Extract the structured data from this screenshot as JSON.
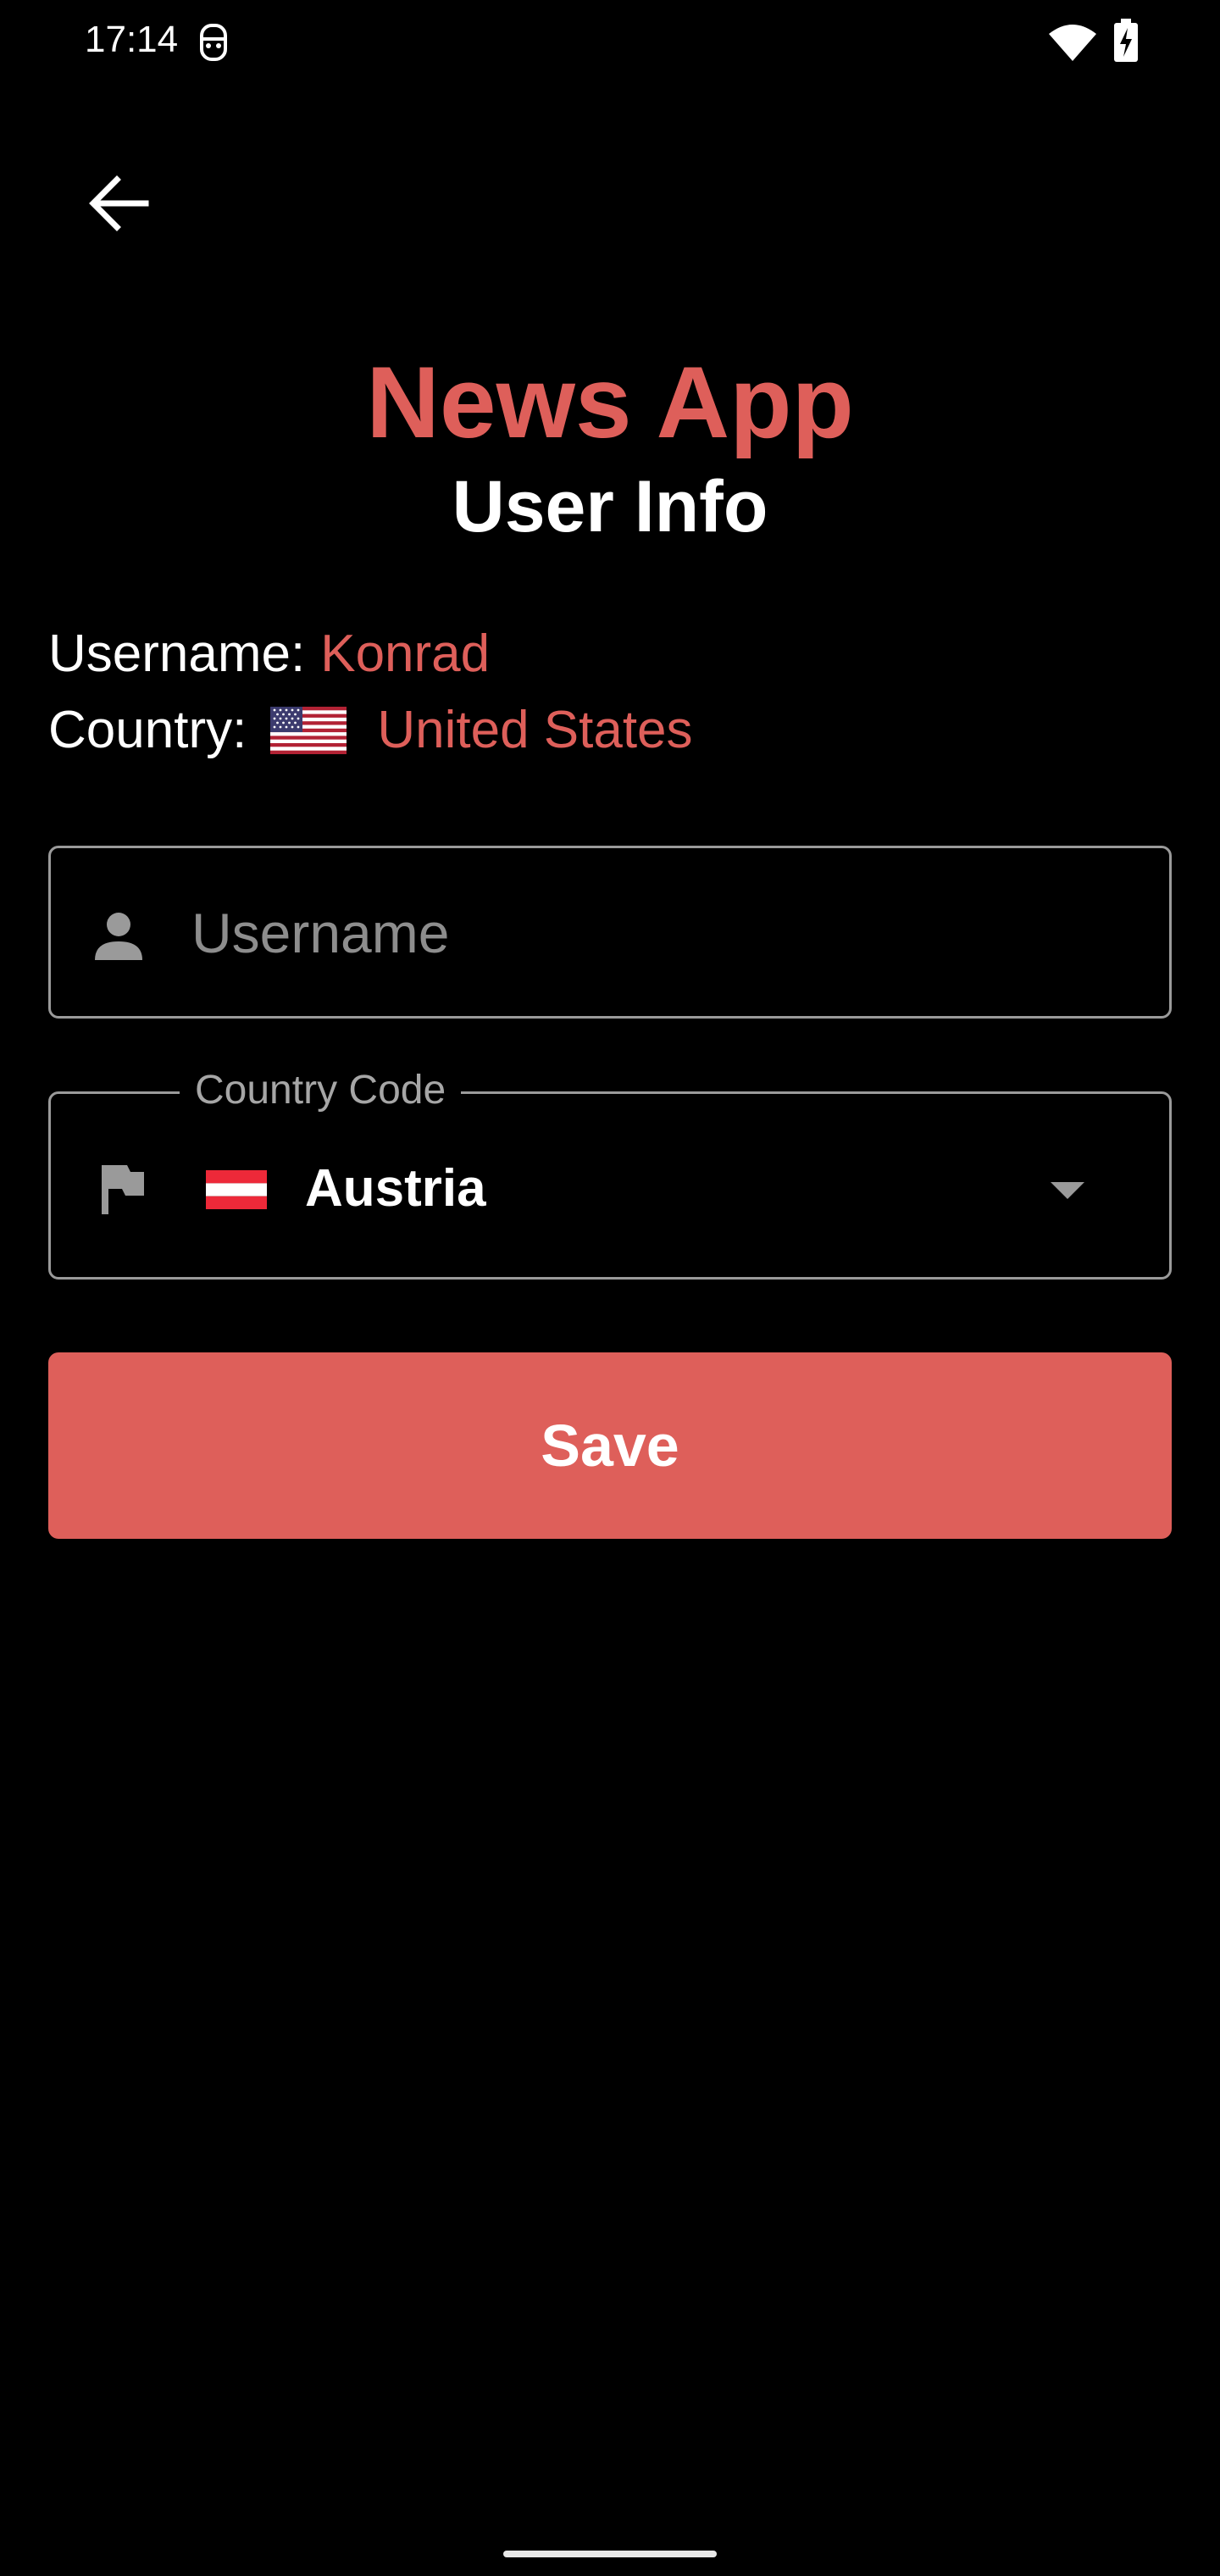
{
  "status_bar": {
    "time": "17:14",
    "icons": [
      "vpn-key-icon",
      "wifi-icon",
      "battery-charging-icon"
    ]
  },
  "header": {
    "back_icon": "arrow-back-icon",
    "app_title": "News App",
    "subtitle": "User Info"
  },
  "user_info": {
    "username_label": "Username:",
    "username_value": "Konrad",
    "country_label": "Country:",
    "country_flag_icon": "us-flag-icon",
    "country_value": "United States"
  },
  "form": {
    "username_field": {
      "icon": "person-icon",
      "placeholder": "Username",
      "value": ""
    },
    "country_field": {
      "label": "Country Code",
      "icon": "flag-icon",
      "selected_flag_icon": "austria-flag-icon",
      "selected_value": "Austria",
      "dropdown_icon": "dropdown-arrow-icon"
    },
    "save_label": "Save"
  },
  "colors": {
    "accent": "#de5f5a",
    "background": "#000000",
    "text": "#ffffff",
    "placeholder": "#8d8d8d",
    "border": "#9a9a9a"
  }
}
